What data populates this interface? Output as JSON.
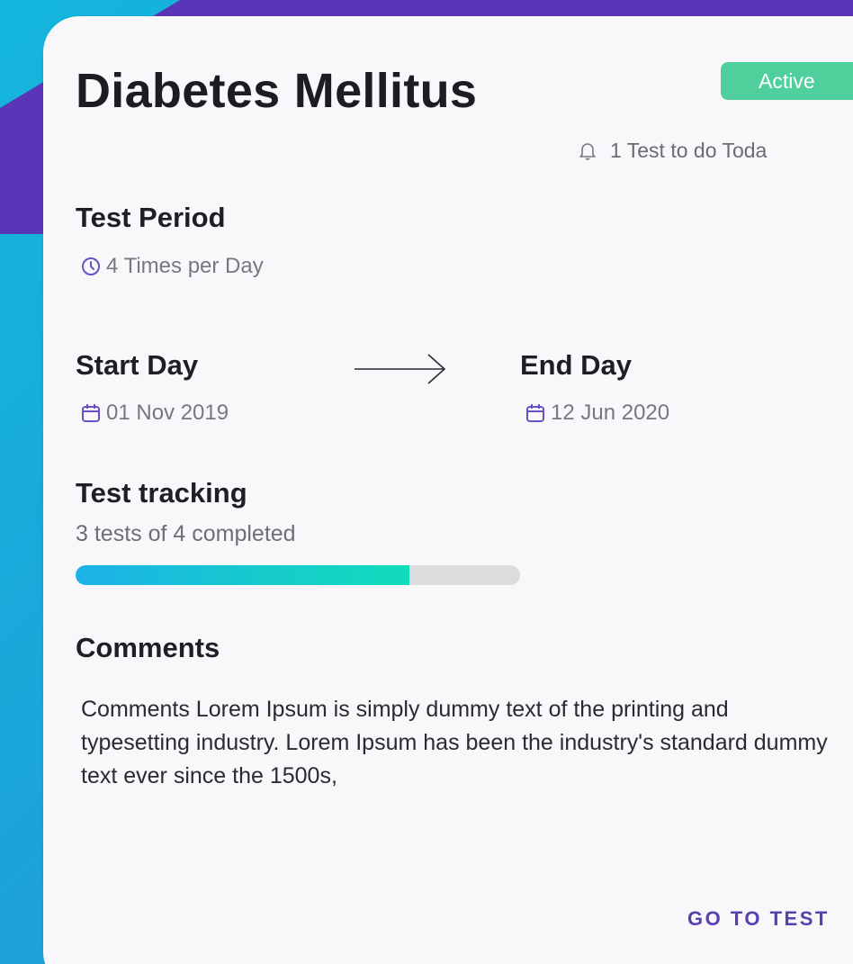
{
  "card": {
    "title": "Diabetes Mellitus",
    "status": "Active",
    "today_notice": "1 Test to do Toda",
    "period": {
      "heading": "Test Period",
      "frequency": "4 Times per Day"
    },
    "start": {
      "heading": "Start Day",
      "date": "01 Nov 2019"
    },
    "end": {
      "heading": "End Day",
      "date": "12 Jun 2020"
    },
    "tracking": {
      "heading": "Test tracking",
      "summary": "3 tests of  4 completed",
      "completed": 3,
      "total": 4
    },
    "comments": {
      "heading": "Comments",
      "text": "Comments Lorem Ipsum is simply dummy text of the printing and typesetting industry. Lorem Ipsum has been the industry's standard dummy text ever since the 1500s,"
    },
    "cta_label": "GO TO TEST"
  },
  "colors": {
    "status_badge": "#4fcf9c",
    "accent_purple": "#5b3fb0",
    "icon_purple": "#6b4fc6",
    "progress_start": "#1cb2e8",
    "progress_end": "#11dcbb"
  },
  "icons": {
    "notice": "bell-icon",
    "frequency": "clock-icon",
    "dates": "calendar-icon",
    "range": "arrow-right-icon"
  }
}
